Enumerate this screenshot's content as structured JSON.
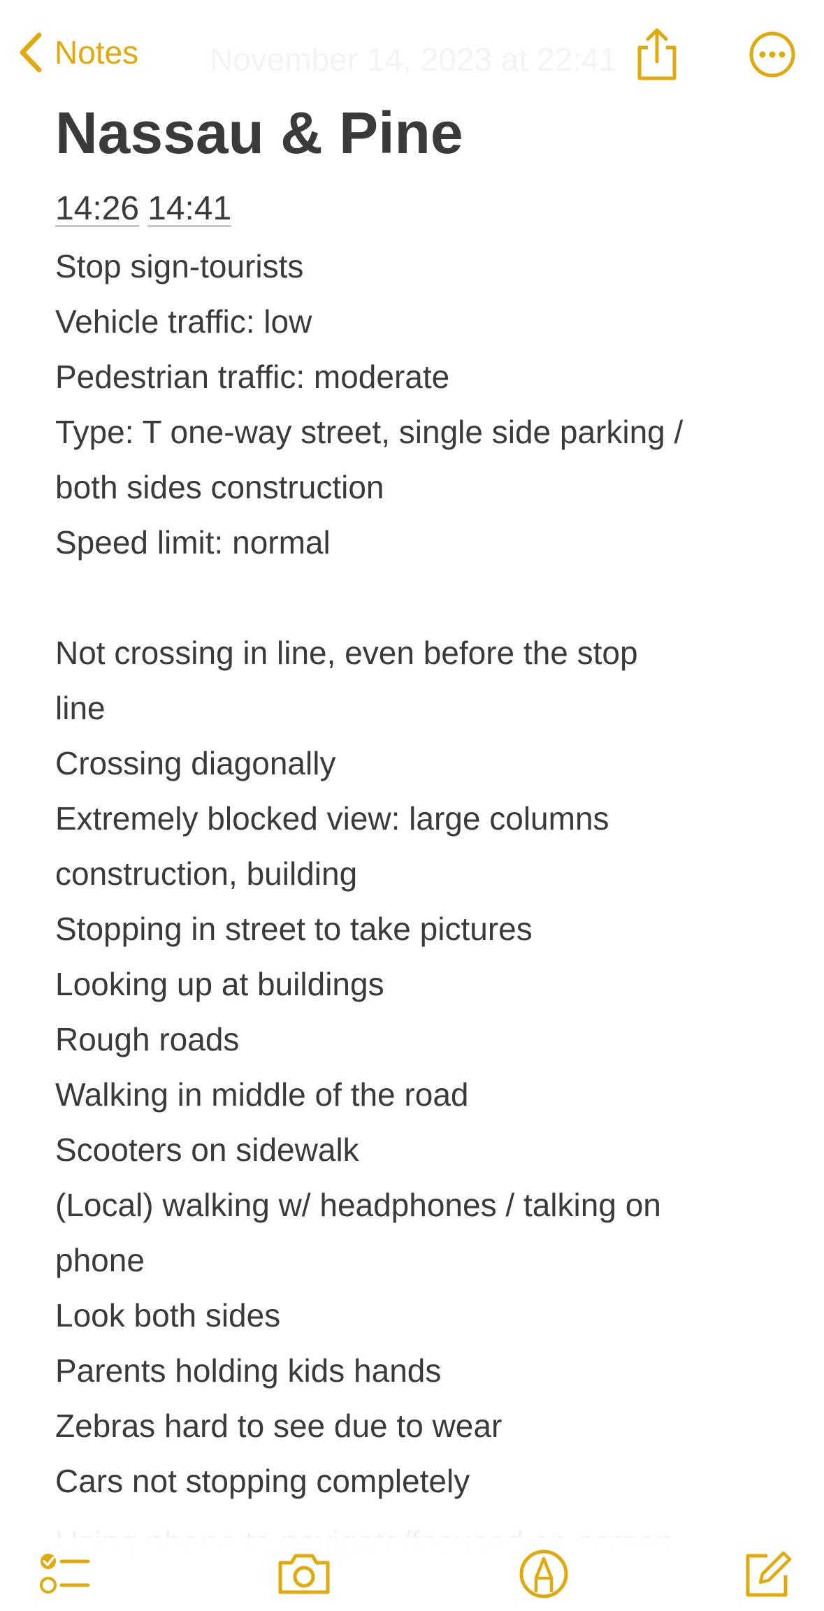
{
  "nav": {
    "back_label": "Notes",
    "date": "November 14, 2023 at 22:41"
  },
  "note": {
    "title": "Nassau & Pine",
    "time_start": "14:26",
    "time_end": "14:41",
    "lines": [
      "Stop sign-tourists",
      "Vehicle traffic: low",
      "Pedestrian traffic: moderate",
      "Type: T one-way street, single side parking /",
      "both sides construction",
      "Speed limit: normal",
      "",
      "Not crossing in line, even before the stop",
      "line",
      "Crossing diagonally",
      "Extremely blocked view: large columns",
      "construction, building",
      "Stopping in street to take pictures",
      "Looking up at buildings",
      "Rough roads",
      "Walking in middle of the road",
      "Scooters on sidewalk",
      "(Local) walking w/ headphones / talking on",
      "phone",
      "Look both sides",
      "Parents holding kids hands",
      "Zebras hard to see due to wear",
      "Cars not stopping completely"
    ],
    "faded_line": "Using phone to navigate/focused on screen"
  },
  "toolbar": {
    "icons": [
      "checklist-icon",
      "camera-icon",
      "markup-icon",
      "compose-icon"
    ]
  },
  "colors": {
    "accent": "#e0a90c",
    "text": "#3a3a3c",
    "background": "#ffffff"
  }
}
